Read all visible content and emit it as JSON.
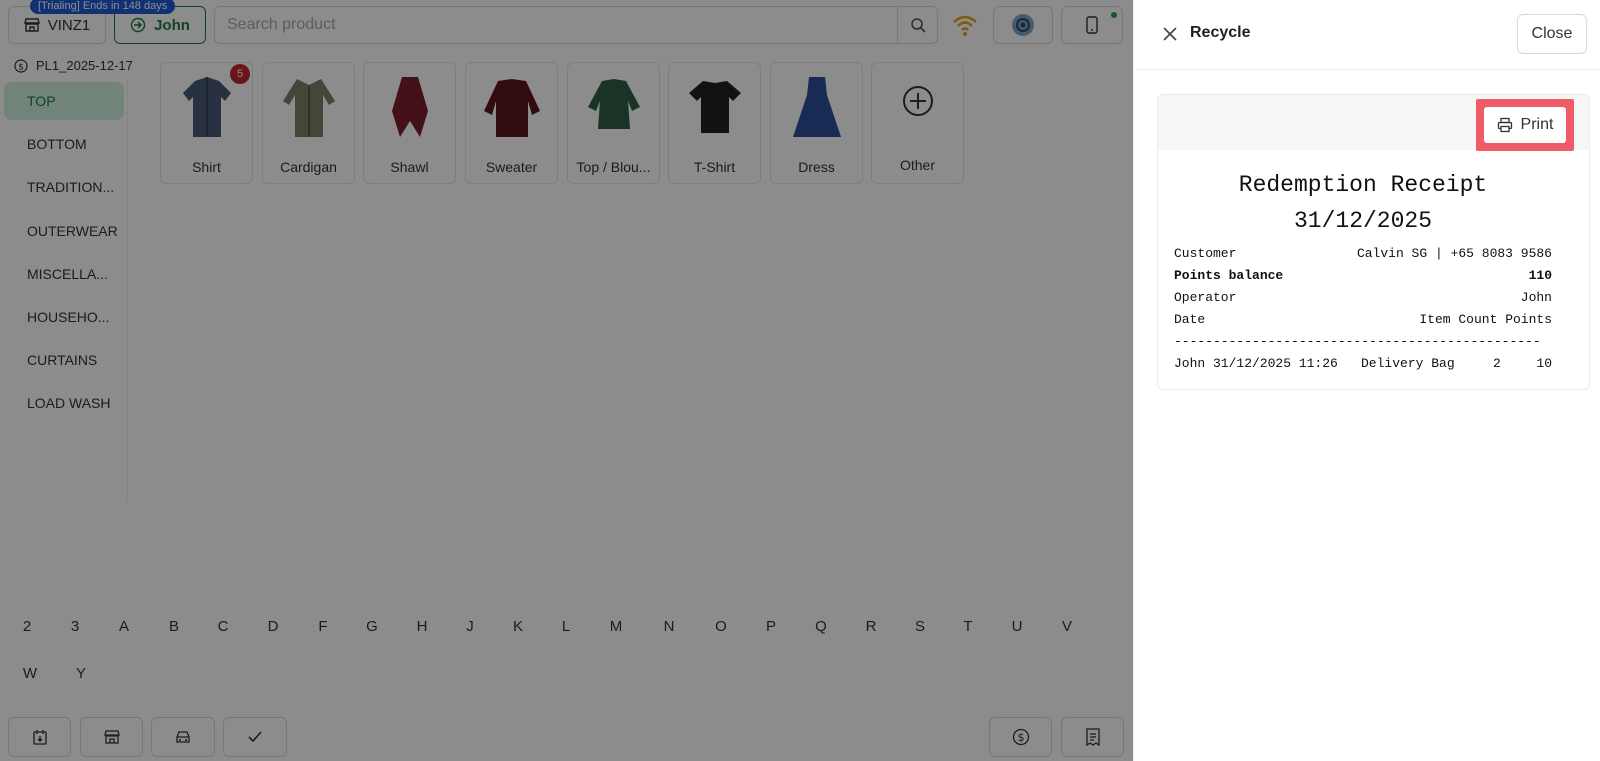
{
  "topbar": {
    "trial_badge": "[Trialing] Ends in 148 days",
    "store_label": "VINZ1",
    "user_label": "John",
    "search_placeholder": "Search product"
  },
  "pricelist": "PL1_2025-12-17",
  "categories": [
    {
      "label": "TOP",
      "active": true
    },
    {
      "label": "BOTTOM"
    },
    {
      "label": "TRADITION..."
    },
    {
      "label": "OUTERWEAR"
    },
    {
      "label": "MISCELLA..."
    },
    {
      "label": "HOUSEHO..."
    },
    {
      "label": "CURTAINS"
    },
    {
      "label": "LOAD WASH"
    }
  ],
  "products": [
    {
      "label": "Shirt",
      "badge": "5"
    },
    {
      "label": "Cardigan"
    },
    {
      "label": "Shawl"
    },
    {
      "label": "Sweater"
    },
    {
      "label": "Top / Blou..."
    },
    {
      "label": "T-Shirt"
    },
    {
      "label": "Dress"
    },
    {
      "label": "Other"
    }
  ],
  "alphabet": [
    "2",
    "3",
    "A",
    "B",
    "C",
    "D",
    "F",
    "G",
    "H",
    "J",
    "K",
    "L",
    "M",
    "N",
    "O",
    "P",
    "Q",
    "R",
    "S",
    "T",
    "U",
    "V",
    "W",
    "Y"
  ],
  "drawer": {
    "title": "Recycle",
    "close_label": "Close",
    "print_label": "Print"
  },
  "receipt": {
    "title": "Redemption Receipt",
    "date": "31/12/2025",
    "customer_label": "Customer",
    "customer_value": "Calvin SG | +65 8083 9586",
    "points_label": "Points balance",
    "points_value": "110",
    "operator_label": "Operator",
    "operator_value": "John",
    "date_label": "Date",
    "columns_header": "Item Count Points",
    "divider": "-----------------------------------------------",
    "line_operator": "John",
    "line_datetime": "31/12/2025 11:26",
    "line_item": "Delivery Bag",
    "line_count": "2",
    "line_points": "10"
  },
  "colors": {
    "accent_green": "#1f7a3e",
    "highlight_red": "#ef5b67",
    "trial_blue": "#1e5bd6",
    "badge_red": "#c4262e"
  }
}
